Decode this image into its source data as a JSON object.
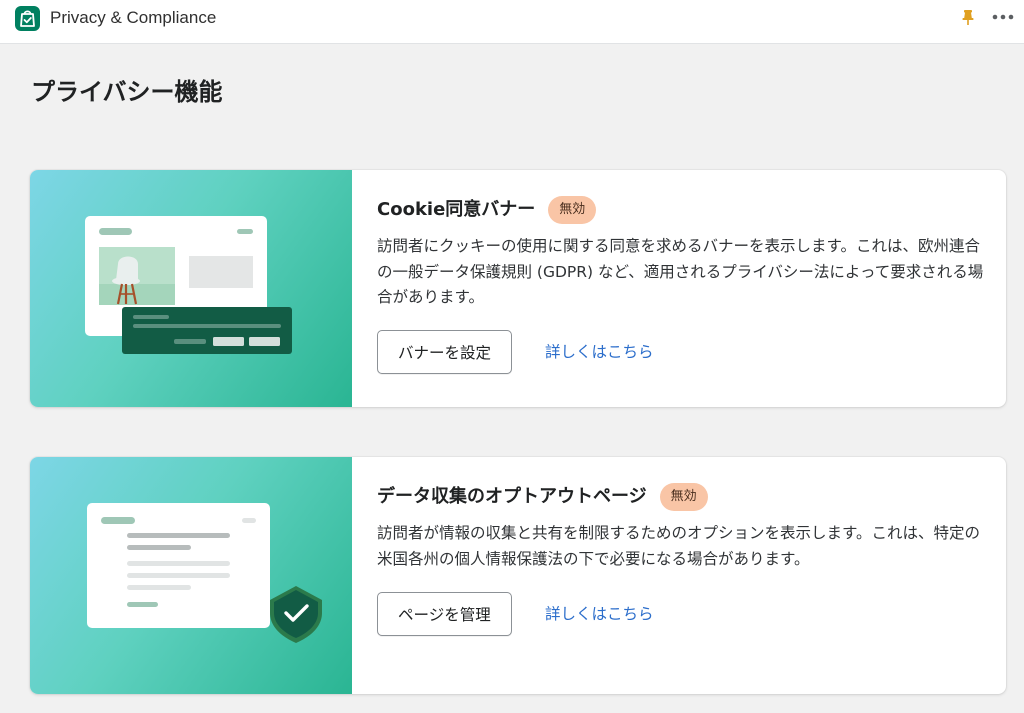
{
  "header": {
    "app_title": "Privacy & Compliance",
    "icons": [
      "shopify-bag-icon",
      "pin-icon",
      "more-icon"
    ]
  },
  "page": {
    "title": "プライバシー機能"
  },
  "cards": [
    {
      "title": "Cookie同意バナー",
      "badge": "無効",
      "description": "訪問者にクッキーの使用に関する同意を求めるバナーを表示します。これは、欧州連合の一般データ保護規則 (GDPR) など、適用されるプライバシー法によって要求される場合があります。",
      "button_label": "バナーを設定",
      "link_label": "詳しくはこちら"
    },
    {
      "title": "データ収集のオプトアウトページ",
      "badge": "無効",
      "description": "訪問者が情報の収集と共有を制限するためのオプションを表示します。これは、特定の米国各州の個人情報保護法の下で必要になる場合があります。",
      "button_label": "ページを管理",
      "link_label": "詳しくはこちら"
    }
  ],
  "colors": {
    "brand_green": "#008060",
    "badge_bg": "#f9c5a6",
    "link": "#2c6ecb",
    "pin": "#e0a021"
  }
}
